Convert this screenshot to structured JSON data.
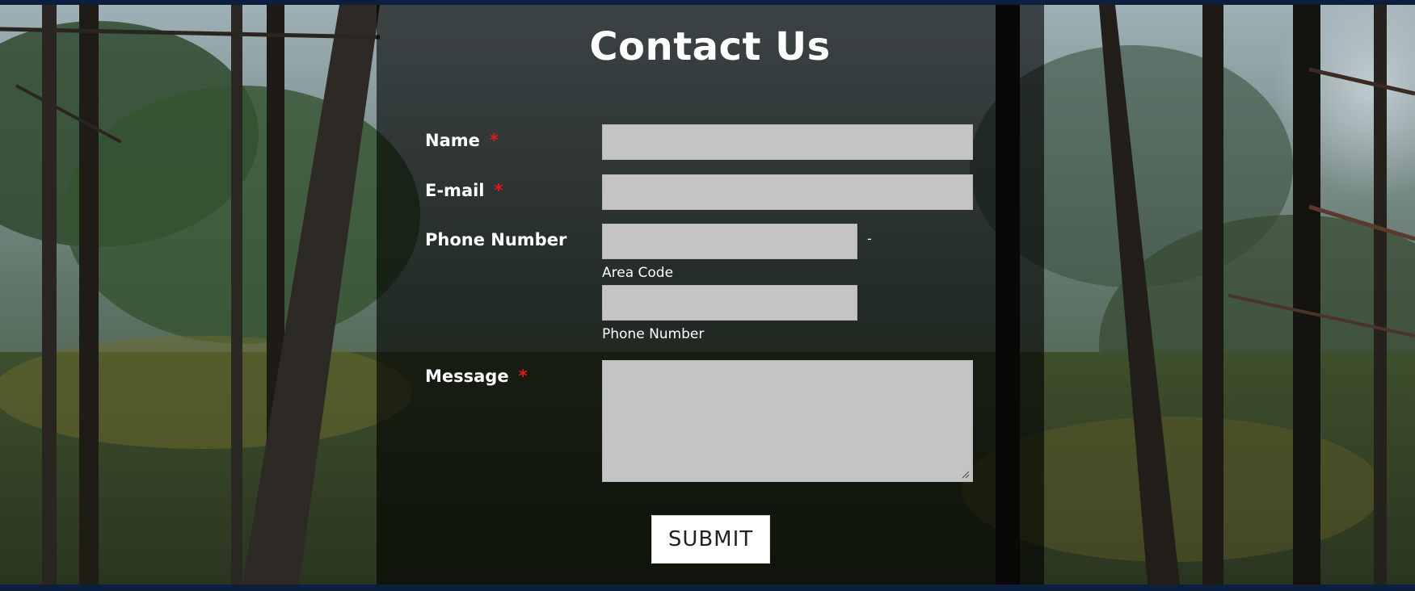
{
  "page": {
    "title": "Contact Us"
  },
  "form": {
    "name_label": "Name",
    "email_label": "E-mail",
    "phone_label": "Phone Number",
    "message_label": "Message",
    "required_marker": "*",
    "phone_separator": "-",
    "area_code_sublabel": "Area Code",
    "phone_number_sublabel": "Phone Number",
    "name_value": "",
    "email_value": "",
    "area_code_value": "",
    "phone_value": "",
    "message_value": "",
    "submit_label": "SUBMIT"
  },
  "colors": {
    "required": "#e0171b",
    "input_bg": "#c4c4c4",
    "overlay": "rgba(0,0,0,0.62)",
    "strip": "#0d1f3f"
  }
}
